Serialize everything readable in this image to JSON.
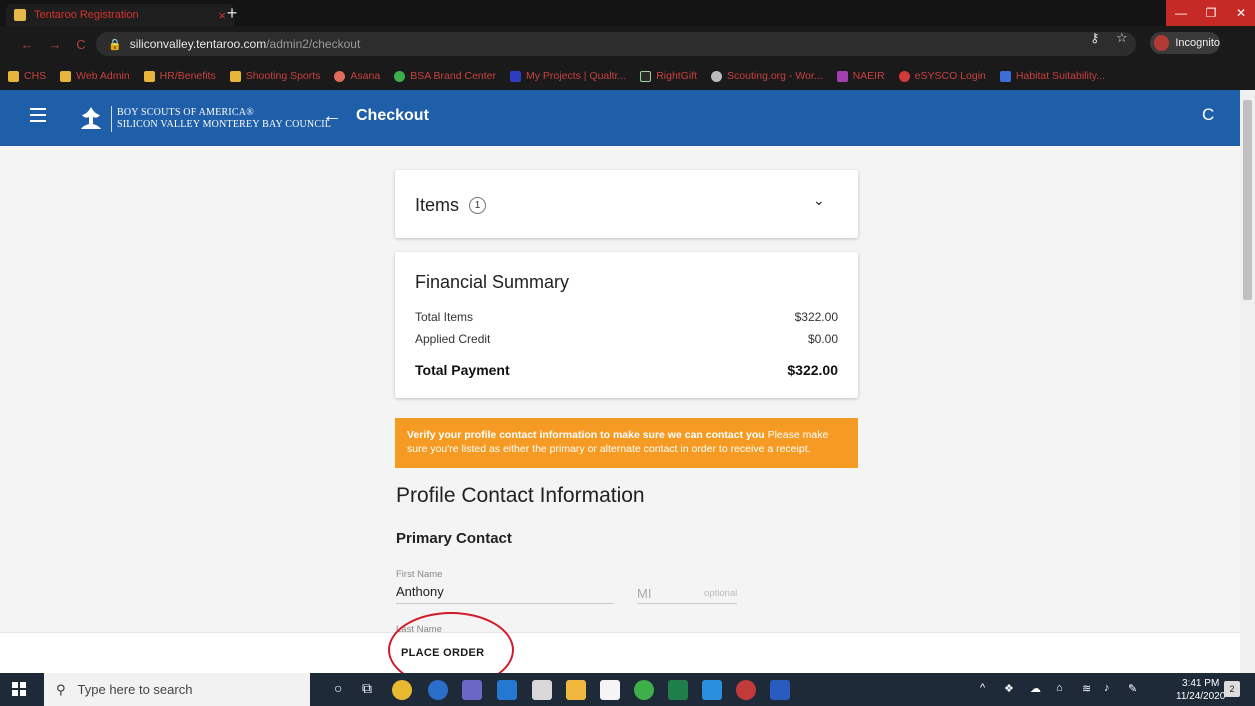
{
  "browser": {
    "tab_title": "Tentaroo Registration",
    "tab_close": "×",
    "new_tab": "+",
    "url_host": "siliconvalley.tentaroo.com",
    "url_path": "/admin2/checkout",
    "profile_label": "Incognito",
    "bookmarks": [
      "CHS",
      "Web Admin",
      "HR/Benefits",
      "Shooting Sports",
      "Asana",
      "BSA Brand Center",
      "My Projects | Qualtr...",
      "RightGift",
      "Scouting.org - Wor...",
      "NAEIR",
      "eSYSCO Login",
      "Habitat Suitability..."
    ]
  },
  "header": {
    "org_line1": "BOY SCOUTS OF AMERICA®",
    "org_line2": "SILICON VALLEY MONTEREY BAY COUNCIL",
    "back_glyph": "←",
    "title": "Checkout",
    "refresh_glyph": "C"
  },
  "items_card": {
    "label": "Items",
    "count": "1",
    "chevron": "⌄"
  },
  "financial": {
    "title": "Financial Summary",
    "rows": [
      {
        "label": "Total Items",
        "value": "$322.00"
      },
      {
        "label": "Applied Credit",
        "value": "$0.00"
      }
    ],
    "total_label": "Total Payment",
    "total_value": "$322.00"
  },
  "alert": {
    "bold": "Verify your profile contact information to make sure we can contact you",
    "text": " Please make sure you're listed as either the primary or alternate contact in order to receive a receipt."
  },
  "profile": {
    "title": "Profile Contact Information",
    "primary_title": "Primary Contact",
    "first_name_label": "First Name",
    "first_name_value": "Anthony",
    "mi_placeholder": "MI",
    "mi_hint": "optional",
    "last_name_label": "Last Name"
  },
  "footer": {
    "place_order": "PLACE ORDER"
  },
  "taskbar": {
    "search_placeholder": "Type here to search",
    "time": "3:41 PM",
    "date": "11/24/2020",
    "notifications": "2"
  },
  "colors": {
    "header_blue": "#1f5ea8",
    "alert_orange": "#f59b23",
    "annotation_red": "#d01b2a"
  }
}
